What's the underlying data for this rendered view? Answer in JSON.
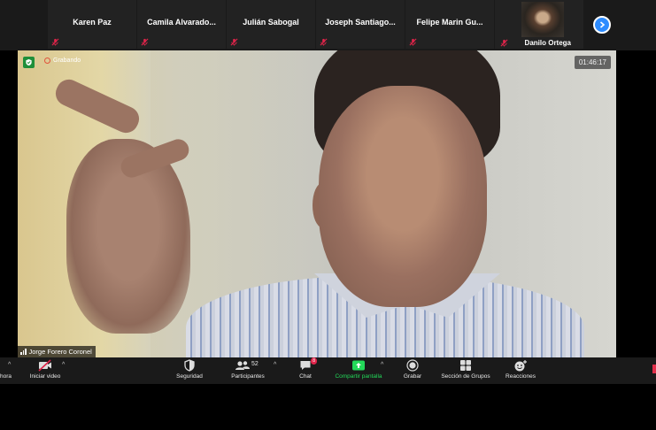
{
  "participants": [
    {
      "name": "Karen Paz",
      "muted": true
    },
    {
      "name": "Camila  Alvarado...",
      "muted": true
    },
    {
      "name": "Julián Sabogal",
      "muted": true
    },
    {
      "name": "Joseph  Santiago...",
      "muted": true
    },
    {
      "name": "Felipe  Marin  Gu...",
      "muted": true
    },
    {
      "name": "Danilo Ortega",
      "muted": true,
      "has_video": true
    }
  ],
  "recording": {
    "label": "Grabando"
  },
  "timer": "01:46:17",
  "active_speaker": {
    "name": "Jorge Forero Coronel"
  },
  "toolbar": {
    "left_partial": "hora",
    "start_video": "Iniciar video",
    "security": "Seguridad",
    "participants": "Participantes",
    "participants_count": "52",
    "chat": "Chat",
    "chat_badge": "8",
    "share_screen": "Compartir pantalla",
    "record": "Grabar",
    "breakout_rooms": "Sección de Grupos",
    "reactions": "Reacciones"
  },
  "colors": {
    "accent_blue": "#2d8cff",
    "muted_red": "#e0244a",
    "share_green": "#23d959",
    "recording_red": "#e0533b"
  }
}
